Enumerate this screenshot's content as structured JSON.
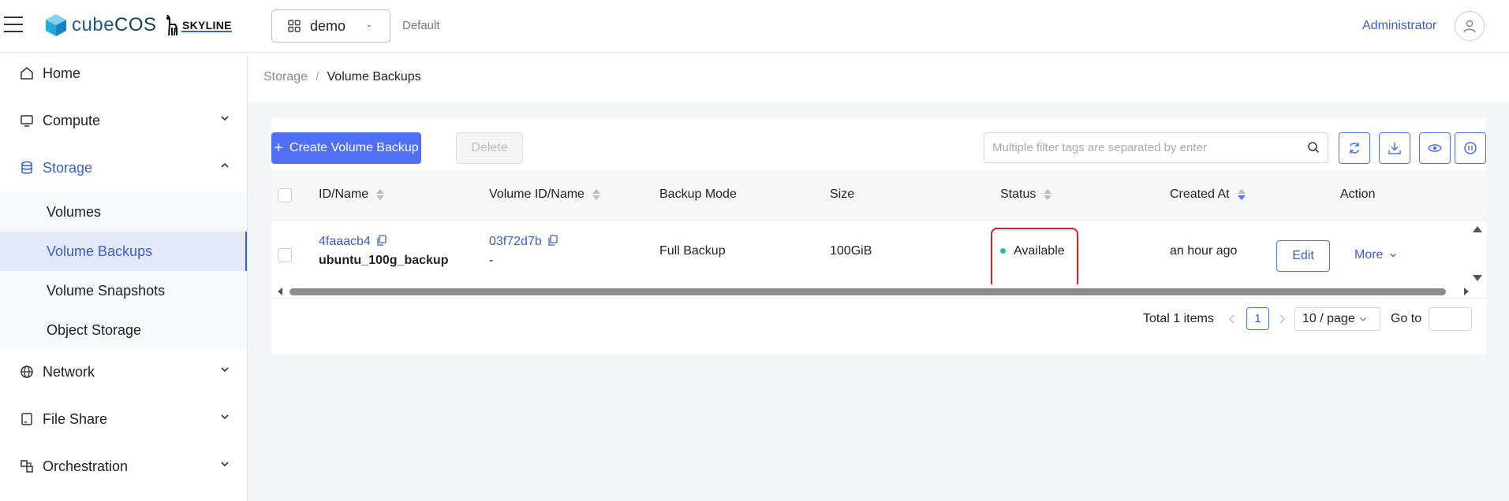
{
  "header": {
    "logo_text_a": "cube",
    "logo_text_b": "COS",
    "partner_logo": "SKYLINE",
    "project_name": "demo",
    "domain": "Default",
    "user": "Administrator"
  },
  "sidebar": {
    "items": [
      {
        "label": "Home",
        "icon": "home-icon"
      },
      {
        "label": "Compute",
        "icon": "monitor-icon"
      },
      {
        "label": "Storage",
        "icon": "database-icon"
      },
      {
        "label": "Network",
        "icon": "globe-icon"
      },
      {
        "label": "File Share",
        "icon": "file-share-icon"
      },
      {
        "label": "Orchestration",
        "icon": "orchestration-icon"
      }
    ],
    "storage_children": [
      "Volumes",
      "Volume Backups",
      "Volume Snapshots",
      "Object Storage"
    ]
  },
  "breadcrumb": {
    "parent": "Storage",
    "separator": "/",
    "current": "Volume Backups"
  },
  "toolbar": {
    "create_label": "Create Volume Backup",
    "delete_label": "Delete",
    "search_placeholder": "Multiple filter tags are separated by enter"
  },
  "table": {
    "columns": [
      "ID/Name",
      "Volume ID/Name",
      "Backup Mode",
      "Size",
      "Status",
      "Created At",
      "Action"
    ],
    "rows": [
      {
        "id": "4faaacb4",
        "name": "ubuntu_100g_backup",
        "volume_id": "03f72d7b",
        "volume_name": "-",
        "backup_mode": "Full Backup",
        "size": "100GiB",
        "status": "Available",
        "created_at": "an hour ago",
        "edit_label": "Edit",
        "more_label": "More"
      }
    ]
  },
  "pagination": {
    "total": "Total 1 items",
    "current_page": "1",
    "page_size": "10 / page",
    "goto_label": "Go to"
  },
  "colors": {
    "accent": "#4f6ff5",
    "status_ok": "#27c386",
    "highlight": "#e02020"
  }
}
